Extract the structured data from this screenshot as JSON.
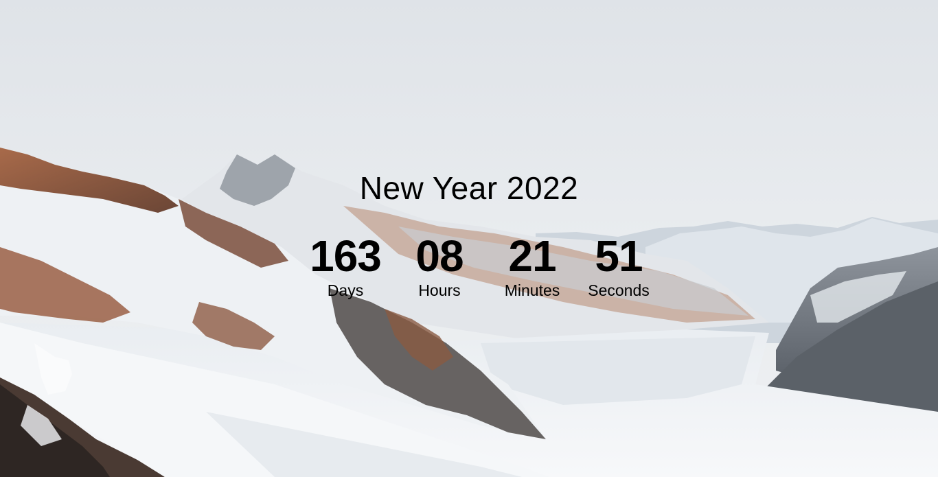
{
  "page": {
    "title": "New Year 2022"
  },
  "countdown": [
    {
      "value": "163",
      "label": "Days"
    },
    {
      "value": "08",
      "label": "Hours"
    },
    {
      "value": "21",
      "label": "Minutes"
    },
    {
      "value": "51",
      "label": "Seconds"
    }
  ],
  "background": {
    "scene": "snowy-mountain-glacier-photo",
    "sky_color": "#e6e9ed",
    "snow_color": "#f3f5f7",
    "rock_color": "#8a5a42"
  }
}
